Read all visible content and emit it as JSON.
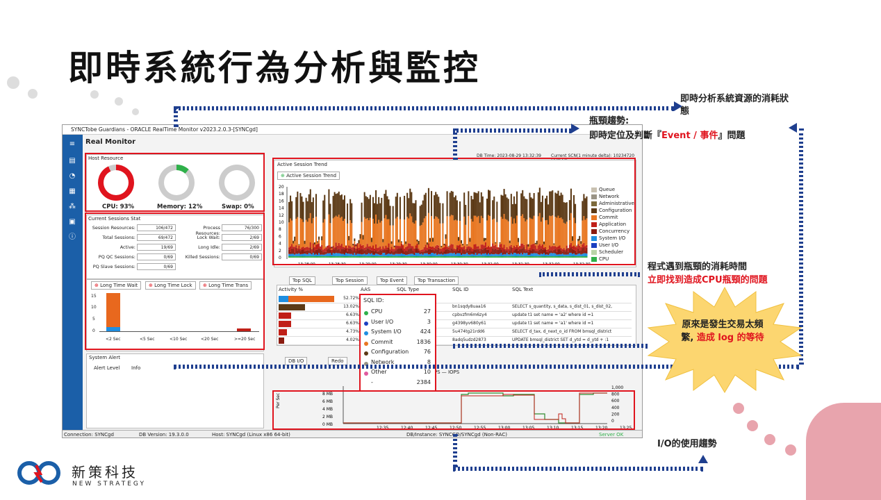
{
  "slide": {
    "title": "即時系統行為分析與監控"
  },
  "window": {
    "title": "SYNCTobe Guardians - ORACLE RealTime Monitor v2023.2.0.3-[SYNCgd]",
    "heading": "Real Monitor",
    "db_time": "DB Time: 2023-08-29 13:32:39",
    "scn": "Current SCN(1 minute delta): 10234720 (27973)"
  },
  "host": {
    "label": "Host Resource",
    "cpu": "CPU: 93%",
    "memory": "Memory: 12%",
    "swap": "Swap: 0%",
    "cpu_pct": 0.93,
    "mem_pct": 0.12,
    "swap_pct": 0.0
  },
  "sessions": {
    "label": "Current Sessions Stat",
    "rows": [
      {
        "l": "Session Resources:",
        "v": "106/472",
        "l2": "Process Resources:",
        "v2": "76/300"
      },
      {
        "l": "Total Sessions:",
        "v": "69/472",
        "l2": "Lock Wait:",
        "v2": "2/69"
      },
      {
        "l": "Active:",
        "v": "19/69",
        "l2": "Long Idle:",
        "v2": "2/69"
      },
      {
        "l": "PQ QC Sessions:",
        "v": "0/69",
        "l2": "Killed Sessions:",
        "v2": "0/69"
      },
      {
        "l": "PQ Slave Sessions:",
        "v": "0/69",
        "l2": "",
        "v2": ""
      }
    ]
  },
  "wait_tabs": [
    "Long Time Wait",
    "Long Time Lock",
    "Long Time Trans"
  ],
  "wait_chart": {
    "categories": [
      "<2 Sec",
      "<5 Sec",
      "<10 Sec",
      "<20 Sec",
      ">=20 Sec"
    ],
    "yticks": [
      "15",
      "10",
      "5",
      "0"
    ]
  },
  "alert": {
    "label": "System Alert",
    "cols": [
      "Alert Level",
      "Info"
    ]
  },
  "trend": {
    "label": "Active Session Trend",
    "tab": "Active Session Trend",
    "yticks": [
      "20",
      "18",
      "16",
      "14",
      "12",
      "10",
      "8",
      "6",
      "4",
      "2",
      "0"
    ],
    "legend": [
      {
        "name": "Queue",
        "color": "#c8c0b0"
      },
      {
        "name": "Network",
        "color": "#9a9486"
      },
      {
        "name": "Administrative",
        "color": "#7d6a3c"
      },
      {
        "name": "Configuration",
        "color": "#5c3a16"
      },
      {
        "name": "Commit",
        "color": "#e87722"
      },
      {
        "name": "Application",
        "color": "#c02018"
      },
      {
        "name": "Concurrency",
        "color": "#8a1c10"
      },
      {
        "name": "System I/O",
        "color": "#1f8ee0"
      },
      {
        "name": "User I/O",
        "color": "#1c3fc0"
      },
      {
        "name": "Scheduler",
        "color": "#b8d4a8"
      },
      {
        "name": "CPU",
        "color": "#2fb04a"
      }
    ]
  },
  "sql_tabs": [
    "Top SQL",
    "Top Session",
    "Top Event",
    "Top Transaction"
  ],
  "sql_table": {
    "cols": [
      "Activity %",
      "AAS",
      "SQL Type",
      "SQL ID",
      "SQL Text"
    ],
    "rows": [
      {
        "pct": "52.72%",
        "id": "",
        "text": ""
      },
      {
        "pct": "13.02%",
        "id": "bn1sqdy8uaa16",
        "text": "SELECT s_quantity, s_data,      s_dist_01, s_dist_02,"
      },
      {
        "pct": "6.63%",
        "id": "cpbvzfm6m6zy4",
        "text": "update t1  set name = 'a2' where id =1"
      },
      {
        "pct": "6.63%",
        "id": "g4398yv680y61",
        "text": "update t1  set name = 'a1' where id =1"
      },
      {
        "pct": "4.73%",
        "id": "5u474tg21rdd6",
        "text": "SELECT d_tax, d_next_o_id    FROM bmsql_district"
      },
      {
        "pct": "4.02%",
        "id": "8adq5udzd2873",
        "text": "UPDATE bmsql_district   SET d_ytd = d_ytd + :1"
      }
    ]
  },
  "tooltip": {
    "header": "SQL ID:",
    "items": [
      {
        "k": "CPU",
        "v": "27",
        "c": "#2fb04a"
      },
      {
        "k": "User I/O",
        "v": "3",
        "c": "#1c3fc0"
      },
      {
        "k": "System I/O",
        "v": "424",
        "c": "#1f8ee0"
      },
      {
        "k": "Commit",
        "v": "1836",
        "c": "#e87722"
      },
      {
        "k": "Configuration",
        "v": "76",
        "c": "#5c3a16"
      },
      {
        "k": "Network",
        "v": "8",
        "c": "#9a9486"
      },
      {
        "k": "Other",
        "v": "10",
        "c": "#e05a9e"
      },
      {
        "k": "-",
        "v": "2384",
        "c": ""
      }
    ]
  },
  "io": {
    "tabs": [
      "DB I/O",
      "Redo"
    ],
    "legend": "MBPS  —  IOPS",
    "ylabel": "Per Sec",
    "yticks": [
      "8 MB",
      "6 MB",
      "4 MB",
      "2 MB",
      "0 MB"
    ],
    "y2ticks": [
      "1,000",
      "800",
      "600",
      "400",
      "200",
      "0"
    ],
    "xticks": [
      "12:35",
      "12:40",
      "12:45",
      "12:50",
      "12:55",
      "13:00",
      "13:05",
      "13:10",
      "13:15",
      "13:20",
      "13:25",
      "13:30"
    ]
  },
  "trend_x": [
    "13:28:00",
    "13:28:30",
    "13:29:00",
    "13:29:30",
    "13:30:00",
    "13:30:30",
    "13:31:00",
    "13:31:30",
    "13:32:00",
    "13:32:30"
  ],
  "status": {
    "conn": "Connection: SYNCgd",
    "ver": "DB Version: 19.3.0.0",
    "host": "Host: SYNCgd (Linux x86 64-bit)",
    "inst": "DB/Instance: SYNCGD/SYNCgd (Non-RAC)",
    "ok": "Server OK"
  },
  "callouts": {
    "c1": "即時分析系統資源的消耗狀態",
    "c2a": "瓶頸趨勢:",
    "c2b": "即時定位及判斷『",
    "c2c": "Event / 事件",
    "c2d": "』問題",
    "c3a": "程式遇到瓶頸的消耗時間",
    "c3b": "立即找到造成CPU瓶頸的問題",
    "c4": "I/O的使用趨勢",
    "burst_a": "原來是發生交易太頻繁, ",
    "burst_b": "造成 log 的等待"
  },
  "logo": {
    "name": "新策科技",
    "sub": "NEW STRATEGY"
  }
}
